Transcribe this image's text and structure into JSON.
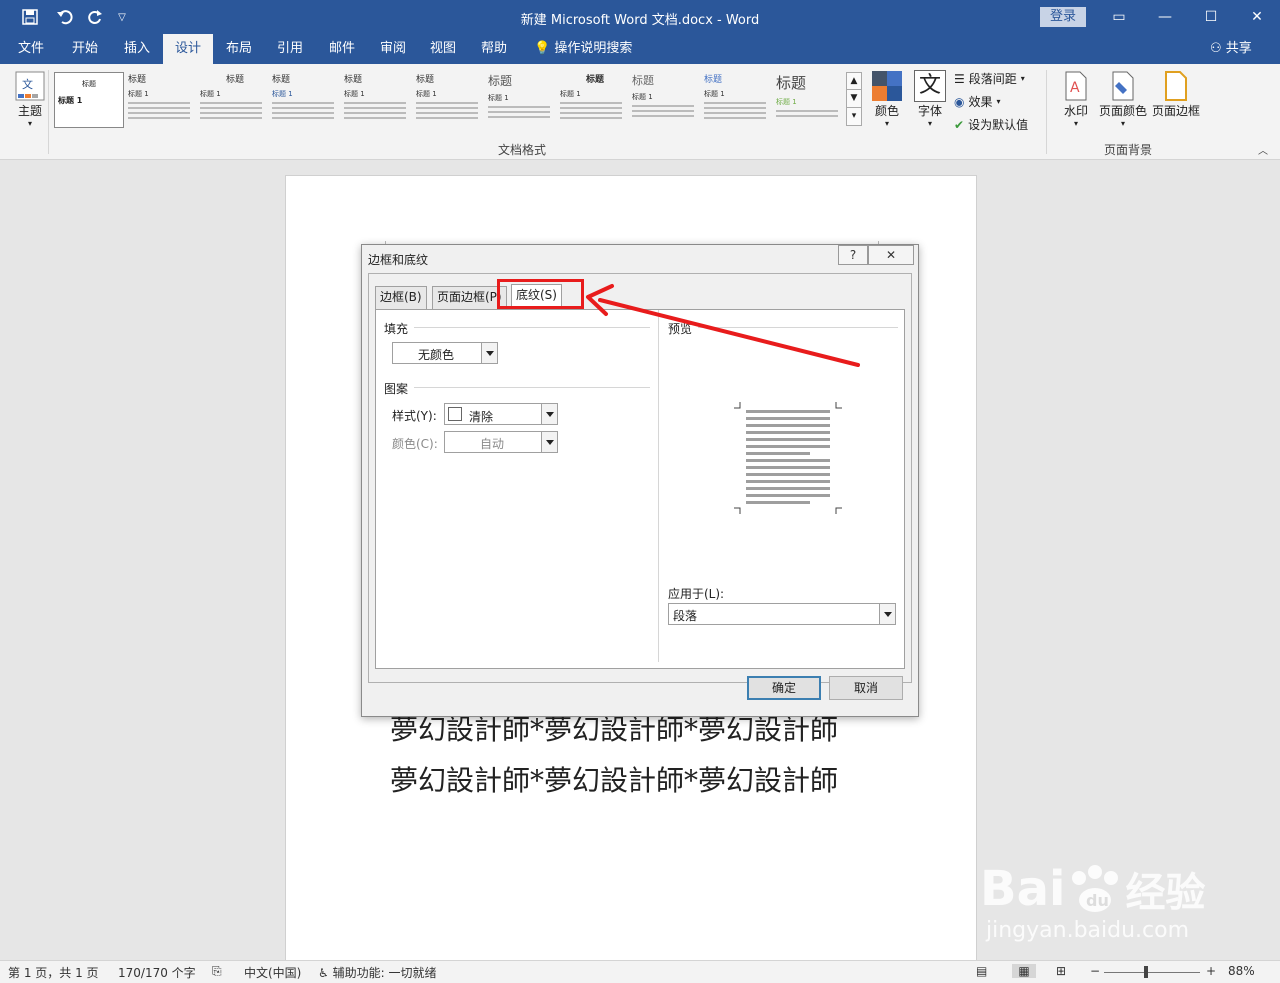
{
  "titlebar": {
    "title": "新建 Microsoft Word 文档.docx  -  Word",
    "login": "登录",
    "minimize": "—",
    "restore": "☐",
    "close": "✕",
    "ribbon_display": "▭"
  },
  "tabs": [
    "文件",
    "开始",
    "插入",
    "设计",
    "布局",
    "引用",
    "邮件",
    "审阅",
    "视图",
    "帮助"
  ],
  "active_tab": "设计",
  "tell_me": "操作说明搜索",
  "share": "共享",
  "ribbon": {
    "theme_label": "主题",
    "styles": [
      {
        "h": "标题",
        "h2": "标题 1"
      },
      {
        "h": "标题",
        "h2": "标题 1"
      },
      {
        "h": "标题",
        "h2": "标题 1"
      },
      {
        "h": "标题",
        "h2": "标题 1"
      },
      {
        "h": "标题",
        "h2": "标题 1"
      },
      {
        "h": "标题",
        "h2": "标题 1"
      },
      {
        "h": "标题",
        "h2": "标题 1"
      },
      {
        "h": "标题",
        "h2": "标题 1"
      },
      {
        "h": "标题",
        "h2": "标题 1"
      },
      {
        "h": "标题",
        "h2": "标题 1"
      },
      {
        "h": "标题",
        "h2": "标题 1"
      }
    ],
    "first_style": {
      "h": "标题",
      "h2": "标题 1"
    },
    "doc_format_group": "文档格式",
    "colors_label": "颜色",
    "fonts_label": "字体",
    "fonts_glyph": "文",
    "para_spacing": "段落间距",
    "effects": "效果",
    "set_default": "设为默认值",
    "watermark_label": "水印",
    "page_color_label": "页面颜色",
    "page_border_label": "页面边框",
    "page_bg_group": "页面背景"
  },
  "document": {
    "lines": [
      "夢幻設計師*夢幻設計師*夢幻設計師",
      "夢幻設計師*夢幻設計師*夢幻設計師"
    ]
  },
  "dialog": {
    "title": "边框和底纹",
    "help": "?",
    "close": "✕",
    "tabs": [
      "边框(B)",
      "页面边框(P)",
      "底纹(S)"
    ],
    "active_tab": "底纹(S)",
    "fill_label": "填充",
    "fill_value": "无颜色",
    "pattern_label": "图案",
    "style_label": "样式(Y):",
    "style_value": "清除",
    "color_label": "颜色(C):",
    "color_value": "自动",
    "preview_label": "预览",
    "apply_label": "应用于(L):",
    "apply_value": "段落",
    "ok": "确定",
    "cancel": "取消"
  },
  "statusbar": {
    "page": "第 1 页，共 1 页",
    "words": "170/170 个字",
    "language": "中文(中国)",
    "accessibility": "辅助功能: 一切就绪",
    "zoom": "88%",
    "zoom_minus": "−",
    "zoom_plus": "+"
  },
  "watermark": {
    "brand": "Bai",
    "brand2": "经验",
    "url": "jingyan.baidu.com"
  },
  "colors": {
    "word_blue": "#2b579a",
    "annotation_red": "#e81c1c"
  }
}
